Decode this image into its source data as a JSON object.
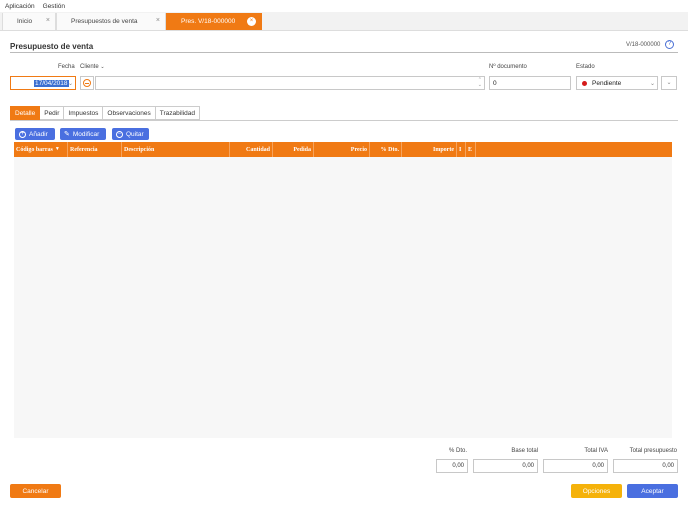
{
  "menu": {
    "items": [
      "Aplicación",
      "Gestión"
    ]
  },
  "tabs": [
    {
      "label": "Inicio"
    },
    {
      "label": "Presupuestos de venta"
    },
    {
      "label": "Pres. V/18-000000"
    }
  ],
  "page": {
    "title": "Presupuesto de venta",
    "doc_id": "V/18-000000",
    "help_icon": "?"
  },
  "form": {
    "fecha_label": "Fecha",
    "fecha_value": "17/04/2018",
    "cliente_label": "Cliente",
    "cliente_value": "",
    "ndoc_label": "Nº documento",
    "ndoc_value": "0",
    "estado_label": "Estado",
    "estado_value": "Pendiente"
  },
  "subtabs": [
    "Detalle",
    "Pedir",
    "Impuestos",
    "Observaciones",
    "Trazabilidad"
  ],
  "actions": {
    "add": "Añadir",
    "edit": "Modificar",
    "remove": "Quitar"
  },
  "grid": {
    "columns": [
      "Código barras",
      "Referencia",
      "Descripción",
      "Cantidad",
      "Pedida",
      "Precio",
      "% Dto.",
      "Importe",
      "I",
      "E"
    ],
    "rows": []
  },
  "totals": {
    "dto_label": "% Dto.",
    "dto_value": "0,00",
    "base_label": "Base total",
    "base_value": "0,00",
    "iva_label": "Total IVA",
    "iva_value": "0,00",
    "pres_label": "Total presupuesto",
    "pres_value": "0,00"
  },
  "footer": {
    "cancel": "Cancelar",
    "options": "Opciones",
    "accept": "Aceptar"
  },
  "colors": {
    "accent": "#f07a14",
    "primary": "#4a6fe0",
    "options": "#f5b20a",
    "status_pending": "#d41a1a"
  }
}
